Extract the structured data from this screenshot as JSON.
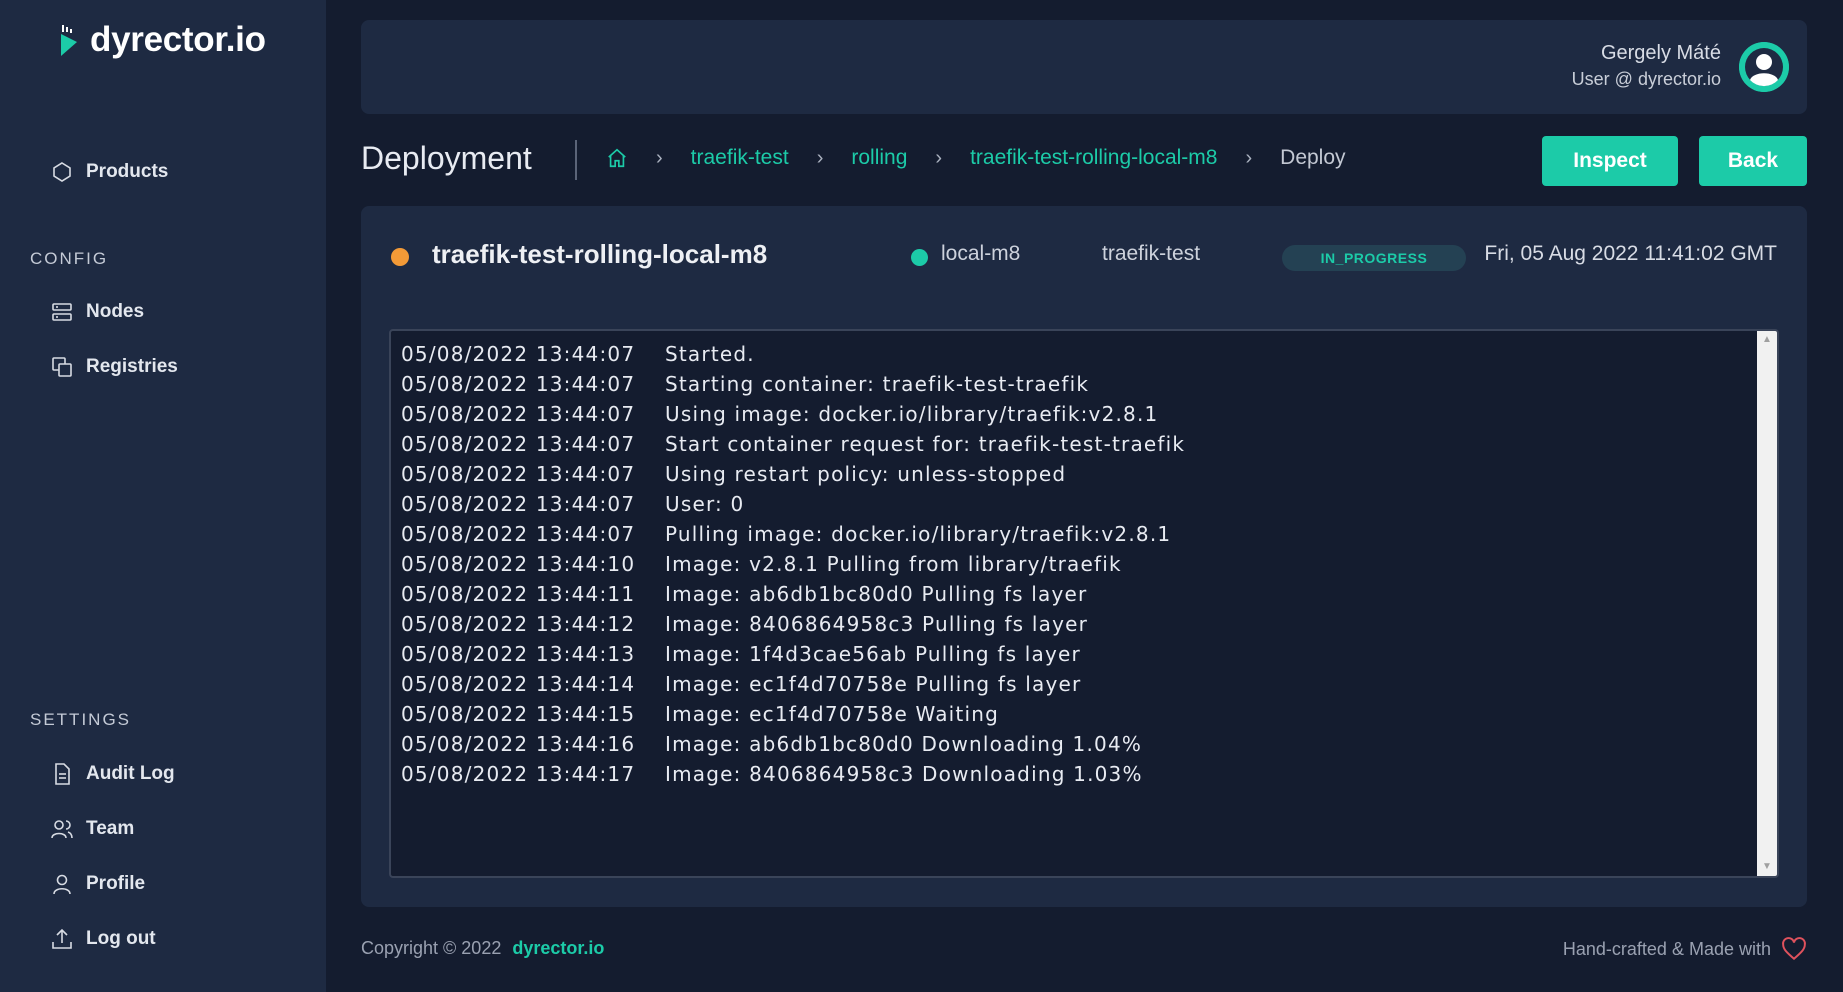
{
  "app": {
    "logo_text": "dyrector.io"
  },
  "sidebar": {
    "products_label": "Products",
    "config_label": "CONFIG",
    "nodes_label": "Nodes",
    "registries_label": "Registries",
    "settings_label": "SETTINGS",
    "audit_log_label": "Audit Log",
    "team_label": "Team",
    "profile_label": "Profile",
    "logout_label": "Log out"
  },
  "user": {
    "name": "Gergely Máté",
    "email": "User @ dyrector.io"
  },
  "page": {
    "title": "Deployment",
    "breadcrumb": [
      "traefik-test",
      "rolling",
      "traefik-test-rolling-local-m8"
    ],
    "breadcrumb_current": "Deploy",
    "inspect_label": "Inspect",
    "back_label": "Back"
  },
  "deployment": {
    "name": "traefik-test-rolling-local-m8",
    "node": "local-m8",
    "product": "traefik-test",
    "status": "IN_PROGRESS",
    "date": "Fri, 05 Aug 2022 11:41:02 GMT"
  },
  "logs": [
    {
      "ts": "05/08/2022 13:44:07",
      "msg": "Started."
    },
    {
      "ts": "05/08/2022 13:44:07",
      "msg": "Starting container: traefik-test-traefik"
    },
    {
      "ts": "05/08/2022 13:44:07",
      "msg": "Using image: docker.io/library/traefik:v2.8.1"
    },
    {
      "ts": "05/08/2022 13:44:07",
      "msg": "Start container request for: traefik-test-traefik"
    },
    {
      "ts": "05/08/2022 13:44:07",
      "msg": "Using restart policy: unless-stopped"
    },
    {
      "ts": "05/08/2022 13:44:07",
      "msg": "User: 0"
    },
    {
      "ts": "05/08/2022 13:44:07",
      "msg": "Pulling image: docker.io/library/traefik:v2.8.1"
    },
    {
      "ts": "05/08/2022 13:44:10",
      "msg": "Image: v2.8.1 Pulling from library/traefik"
    },
    {
      "ts": "05/08/2022 13:44:11",
      "msg": "Image: ab6db1bc80d0 Pulling fs layer"
    },
    {
      "ts": "05/08/2022 13:44:12",
      "msg": "Image: 8406864958c3 Pulling fs layer"
    },
    {
      "ts": "05/08/2022 13:44:13",
      "msg": "Image: 1f4d3cae56ab Pulling fs layer"
    },
    {
      "ts": "05/08/2022 13:44:14",
      "msg": "Image: ec1f4d70758e Pulling fs layer"
    },
    {
      "ts": "05/08/2022 13:44:15",
      "msg": "Image: ec1f4d70758e Waiting"
    },
    {
      "ts": "05/08/2022 13:44:16",
      "msg": "Image: ab6db1bc80d0 Downloading 1.04%"
    },
    {
      "ts": "05/08/2022 13:44:17",
      "msg": "Image: 8406864958c3 Downloading 1.03%"
    }
  ],
  "footer": {
    "copyright": "Copyright © 2022",
    "brand": "dyrector.io",
    "made_with": "Hand-crafted & Made with"
  },
  "colors": {
    "accent": "#1ccba8",
    "status_in_progress": "#f39a37",
    "background": "#141c2f",
    "panel": "#1e2a42"
  },
  "icons": [
    "logo-mark-icon",
    "products-icon",
    "nodes-icon",
    "registries-icon",
    "audit-log-icon",
    "team-icon",
    "profile-icon",
    "logout-icon",
    "home-icon",
    "chevron-right-icon",
    "heart-icon",
    "avatar-icon"
  ]
}
